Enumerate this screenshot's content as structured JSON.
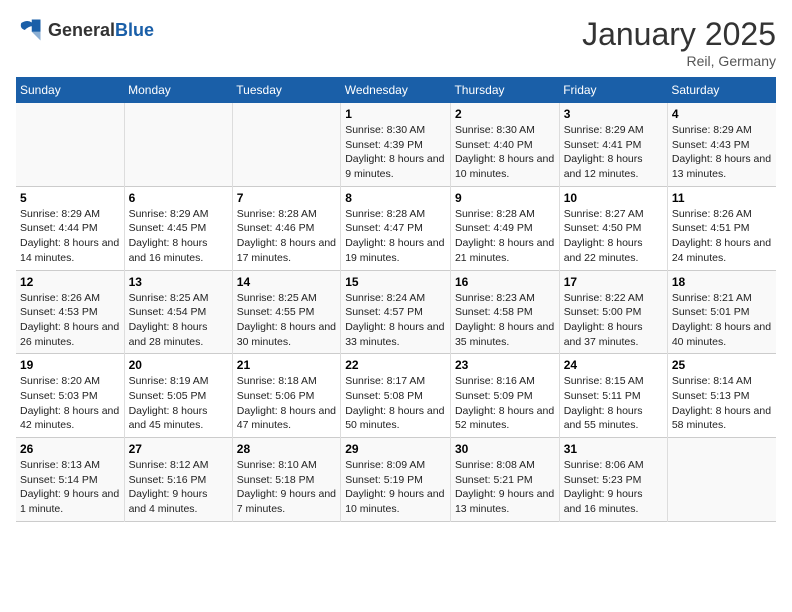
{
  "logo": {
    "general": "General",
    "blue": "Blue"
  },
  "title": "January 2025",
  "subtitle": "Reil, Germany",
  "weekdays": [
    "Sunday",
    "Monday",
    "Tuesday",
    "Wednesday",
    "Thursday",
    "Friday",
    "Saturday"
  ],
  "rows": [
    [
      {
        "day": "",
        "text": ""
      },
      {
        "day": "",
        "text": ""
      },
      {
        "day": "",
        "text": ""
      },
      {
        "day": "1",
        "text": "Sunrise: 8:30 AM\nSunset: 4:39 PM\nDaylight: 8 hours and 9 minutes."
      },
      {
        "day": "2",
        "text": "Sunrise: 8:30 AM\nSunset: 4:40 PM\nDaylight: 8 hours and 10 minutes."
      },
      {
        "day": "3",
        "text": "Sunrise: 8:29 AM\nSunset: 4:41 PM\nDaylight: 8 hours and 12 minutes."
      },
      {
        "day": "4",
        "text": "Sunrise: 8:29 AM\nSunset: 4:43 PM\nDaylight: 8 hours and 13 minutes."
      }
    ],
    [
      {
        "day": "5",
        "text": "Sunrise: 8:29 AM\nSunset: 4:44 PM\nDaylight: 8 hours and 14 minutes."
      },
      {
        "day": "6",
        "text": "Sunrise: 8:29 AM\nSunset: 4:45 PM\nDaylight: 8 hours and 16 minutes."
      },
      {
        "day": "7",
        "text": "Sunrise: 8:28 AM\nSunset: 4:46 PM\nDaylight: 8 hours and 17 minutes."
      },
      {
        "day": "8",
        "text": "Sunrise: 8:28 AM\nSunset: 4:47 PM\nDaylight: 8 hours and 19 minutes."
      },
      {
        "day": "9",
        "text": "Sunrise: 8:28 AM\nSunset: 4:49 PM\nDaylight: 8 hours and 21 minutes."
      },
      {
        "day": "10",
        "text": "Sunrise: 8:27 AM\nSunset: 4:50 PM\nDaylight: 8 hours and 22 minutes."
      },
      {
        "day": "11",
        "text": "Sunrise: 8:26 AM\nSunset: 4:51 PM\nDaylight: 8 hours and 24 minutes."
      }
    ],
    [
      {
        "day": "12",
        "text": "Sunrise: 8:26 AM\nSunset: 4:53 PM\nDaylight: 8 hours and 26 minutes."
      },
      {
        "day": "13",
        "text": "Sunrise: 8:25 AM\nSunset: 4:54 PM\nDaylight: 8 hours and 28 minutes."
      },
      {
        "day": "14",
        "text": "Sunrise: 8:25 AM\nSunset: 4:55 PM\nDaylight: 8 hours and 30 minutes."
      },
      {
        "day": "15",
        "text": "Sunrise: 8:24 AM\nSunset: 4:57 PM\nDaylight: 8 hours and 33 minutes."
      },
      {
        "day": "16",
        "text": "Sunrise: 8:23 AM\nSunset: 4:58 PM\nDaylight: 8 hours and 35 minutes."
      },
      {
        "day": "17",
        "text": "Sunrise: 8:22 AM\nSunset: 5:00 PM\nDaylight: 8 hours and 37 minutes."
      },
      {
        "day": "18",
        "text": "Sunrise: 8:21 AM\nSunset: 5:01 PM\nDaylight: 8 hours and 40 minutes."
      }
    ],
    [
      {
        "day": "19",
        "text": "Sunrise: 8:20 AM\nSunset: 5:03 PM\nDaylight: 8 hours and 42 minutes."
      },
      {
        "day": "20",
        "text": "Sunrise: 8:19 AM\nSunset: 5:05 PM\nDaylight: 8 hours and 45 minutes."
      },
      {
        "day": "21",
        "text": "Sunrise: 8:18 AM\nSunset: 5:06 PM\nDaylight: 8 hours and 47 minutes."
      },
      {
        "day": "22",
        "text": "Sunrise: 8:17 AM\nSunset: 5:08 PM\nDaylight: 8 hours and 50 minutes."
      },
      {
        "day": "23",
        "text": "Sunrise: 8:16 AM\nSunset: 5:09 PM\nDaylight: 8 hours and 52 minutes."
      },
      {
        "day": "24",
        "text": "Sunrise: 8:15 AM\nSunset: 5:11 PM\nDaylight: 8 hours and 55 minutes."
      },
      {
        "day": "25",
        "text": "Sunrise: 8:14 AM\nSunset: 5:13 PM\nDaylight: 8 hours and 58 minutes."
      }
    ],
    [
      {
        "day": "26",
        "text": "Sunrise: 8:13 AM\nSunset: 5:14 PM\nDaylight: 9 hours and 1 minute."
      },
      {
        "day": "27",
        "text": "Sunrise: 8:12 AM\nSunset: 5:16 PM\nDaylight: 9 hours and 4 minutes."
      },
      {
        "day": "28",
        "text": "Sunrise: 8:10 AM\nSunset: 5:18 PM\nDaylight: 9 hours and 7 minutes."
      },
      {
        "day": "29",
        "text": "Sunrise: 8:09 AM\nSunset: 5:19 PM\nDaylight: 9 hours and 10 minutes."
      },
      {
        "day": "30",
        "text": "Sunrise: 8:08 AM\nSunset: 5:21 PM\nDaylight: 9 hours and 13 minutes."
      },
      {
        "day": "31",
        "text": "Sunrise: 8:06 AM\nSunset: 5:23 PM\nDaylight: 9 hours and 16 minutes."
      },
      {
        "day": "",
        "text": ""
      }
    ]
  ]
}
